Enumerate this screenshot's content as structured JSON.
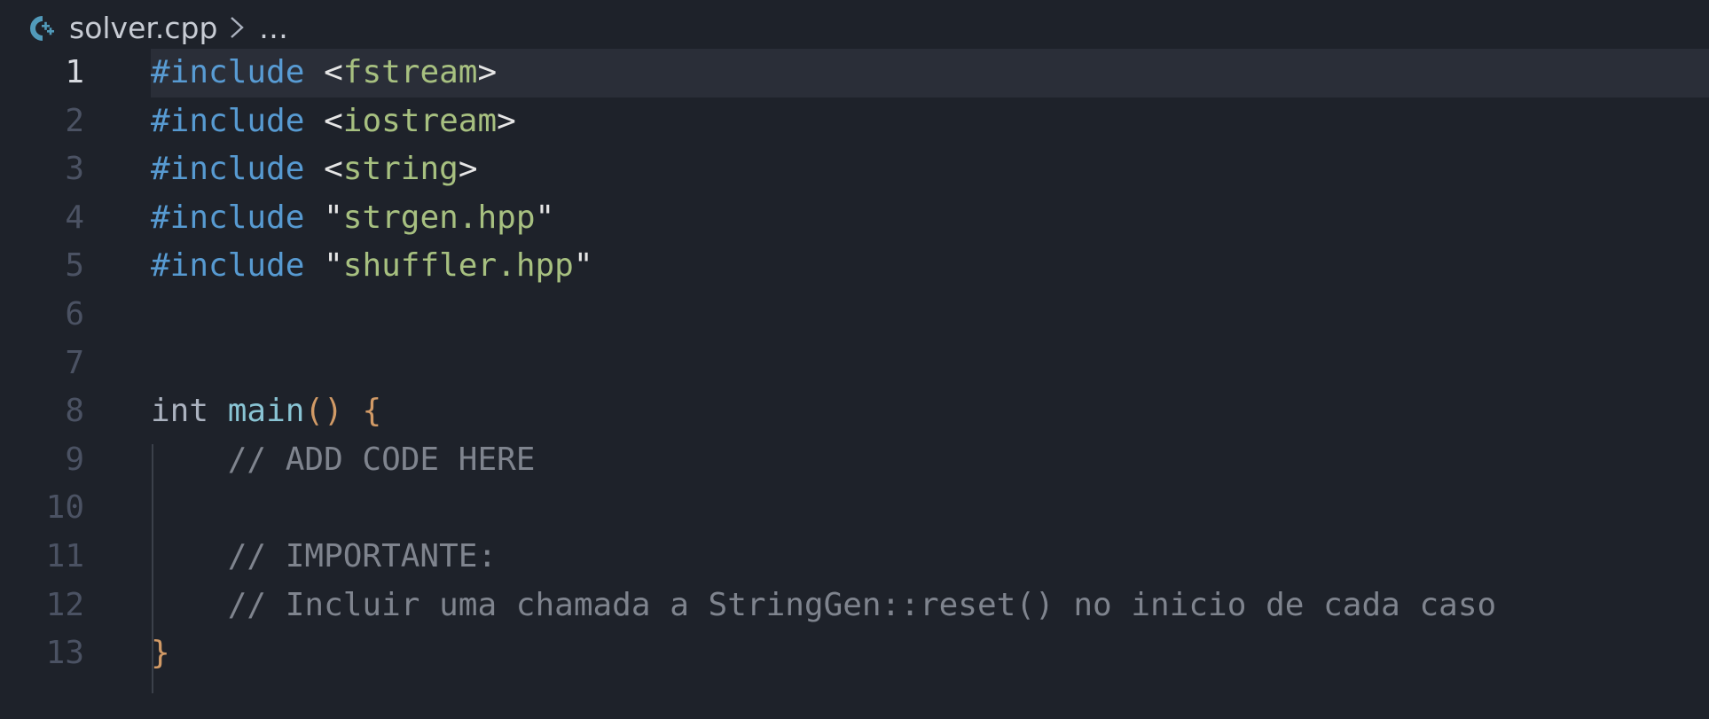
{
  "breadcrumb": {
    "file_name": "solver.cpp",
    "ellipsis": "…",
    "file_icon": "cpp-icon",
    "separator_icon": "chevron-right-icon"
  },
  "editor": {
    "current_line": 1,
    "lines": [
      {
        "number": "1",
        "tokens": [
          {
            "t": "#include",
            "c": "directive"
          },
          {
            "t": " ",
            "c": "punct"
          },
          {
            "t": "<",
            "c": "punct"
          },
          {
            "t": "fstream",
            "c": "string"
          },
          {
            "t": ">",
            "c": "punct"
          }
        ]
      },
      {
        "number": "2",
        "tokens": [
          {
            "t": "#include",
            "c": "directive"
          },
          {
            "t": " ",
            "c": "punct"
          },
          {
            "t": "<",
            "c": "punct"
          },
          {
            "t": "iostream",
            "c": "string"
          },
          {
            "t": ">",
            "c": "punct"
          }
        ]
      },
      {
        "number": "3",
        "tokens": [
          {
            "t": "#include",
            "c": "directive"
          },
          {
            "t": " ",
            "c": "punct"
          },
          {
            "t": "<",
            "c": "punct"
          },
          {
            "t": "string",
            "c": "string"
          },
          {
            "t": ">",
            "c": "punct"
          }
        ]
      },
      {
        "number": "4",
        "tokens": [
          {
            "t": "#include",
            "c": "directive"
          },
          {
            "t": " ",
            "c": "punct"
          },
          {
            "t": "\"",
            "c": "punct"
          },
          {
            "t": "strgen.hpp",
            "c": "string"
          },
          {
            "t": "\"",
            "c": "punct"
          }
        ]
      },
      {
        "number": "5",
        "tokens": [
          {
            "t": "#include",
            "c": "directive"
          },
          {
            "t": " ",
            "c": "punct"
          },
          {
            "t": "\"",
            "c": "punct"
          },
          {
            "t": "shuffler.hpp",
            "c": "string"
          },
          {
            "t": "\"",
            "c": "punct"
          }
        ]
      },
      {
        "number": "6",
        "tokens": []
      },
      {
        "number": "7",
        "tokens": []
      },
      {
        "number": "8",
        "tokens": [
          {
            "t": "int",
            "c": "type"
          },
          {
            "t": " ",
            "c": "punct"
          },
          {
            "t": "main",
            "c": "func"
          },
          {
            "t": "()",
            "c": "brace"
          },
          {
            "t": " ",
            "c": "punct"
          },
          {
            "t": "{",
            "c": "brace"
          }
        ]
      },
      {
        "number": "9",
        "tokens": [
          {
            "t": "    // ADD CODE HERE",
            "c": "comment"
          }
        ]
      },
      {
        "number": "10",
        "tokens": []
      },
      {
        "number": "11",
        "tokens": [
          {
            "t": "    // IMPORTANTE:",
            "c": "comment"
          }
        ]
      },
      {
        "number": "12",
        "tokens": [
          {
            "t": "    // Incluir uma chamada a StringGen::reset() no inicio de cada caso",
            "c": "comment"
          }
        ]
      },
      {
        "number": "13",
        "tokens": [
          {
            "t": "}",
            "c": "brace"
          }
        ]
      }
    ]
  },
  "colors": {
    "background": "#1e222a",
    "current_line": "#2a2e38",
    "cpp_icon": "#519aba"
  }
}
